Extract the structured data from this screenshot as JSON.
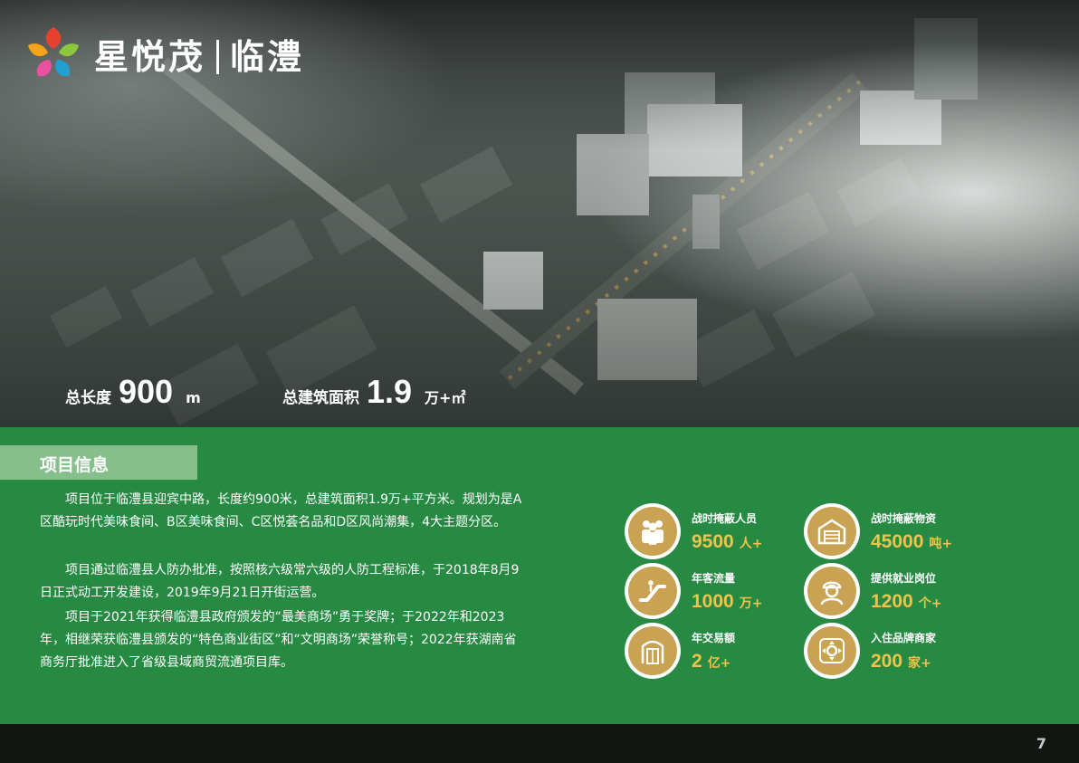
{
  "brand": {
    "name": "星悦茂",
    "city": "临澧"
  },
  "hero_stats": [
    {
      "label": "总长度",
      "value": "900",
      "unit": "m"
    },
    {
      "label": "总建筑面积",
      "value": "1.9",
      "unit": "万+㎡"
    }
  ],
  "section": {
    "title": "项目信息"
  },
  "paragraphs": [
    "项目位于临澧县迎宾中路，长度约900米，总建筑面积1.9万+平方米。规划为是A区酷玩时代美味食间、B区美味食间、C区悦荟名品和D区风尚潮集，4大主题分区。",
    "项目通过临澧县人防办批准，按照核六级常六级的人防工程标准，于2018年8月9日正式动工开发建设，2019年9月21日开街运营。",
    "项目于2021年获得临澧县政府颁发的“最美商场”勇于奖牌；于2022年和2023年，相继荣获临澧县颁发的“特色商业街区”和“文明商场”荣誉称号；2022年获湖南省商务厅批准进入了省级县域商贸流通项目库。"
  ],
  "metrics": [
    {
      "label": "战时掩蔽人员",
      "value": "9500",
      "unit": "人+",
      "icon": "people-icon"
    },
    {
      "label": "战时掩蔽物资",
      "value": "45000",
      "unit": "吨+",
      "icon": "warehouse-icon"
    },
    {
      "label": "年客流量",
      "value": "1000",
      "unit": "万+",
      "icon": "escalator-icon"
    },
    {
      "label": "提供就业岗位",
      "value": "1200",
      "unit": "个+",
      "icon": "worker-icon"
    },
    {
      "label": "年交易额",
      "value": "2",
      "unit": "亿+",
      "icon": "storefront-icon"
    },
    {
      "label": "入住品牌商家",
      "value": "200",
      "unit": "家+",
      "icon": "brand-compass-icon"
    }
  ],
  "footer": {
    "page_number": "7"
  },
  "colors": {
    "band_green": "#268a43",
    "tab_green": "#85bf8c",
    "gold": "#c9a353",
    "value_yellow": "#f2c34a"
  }
}
